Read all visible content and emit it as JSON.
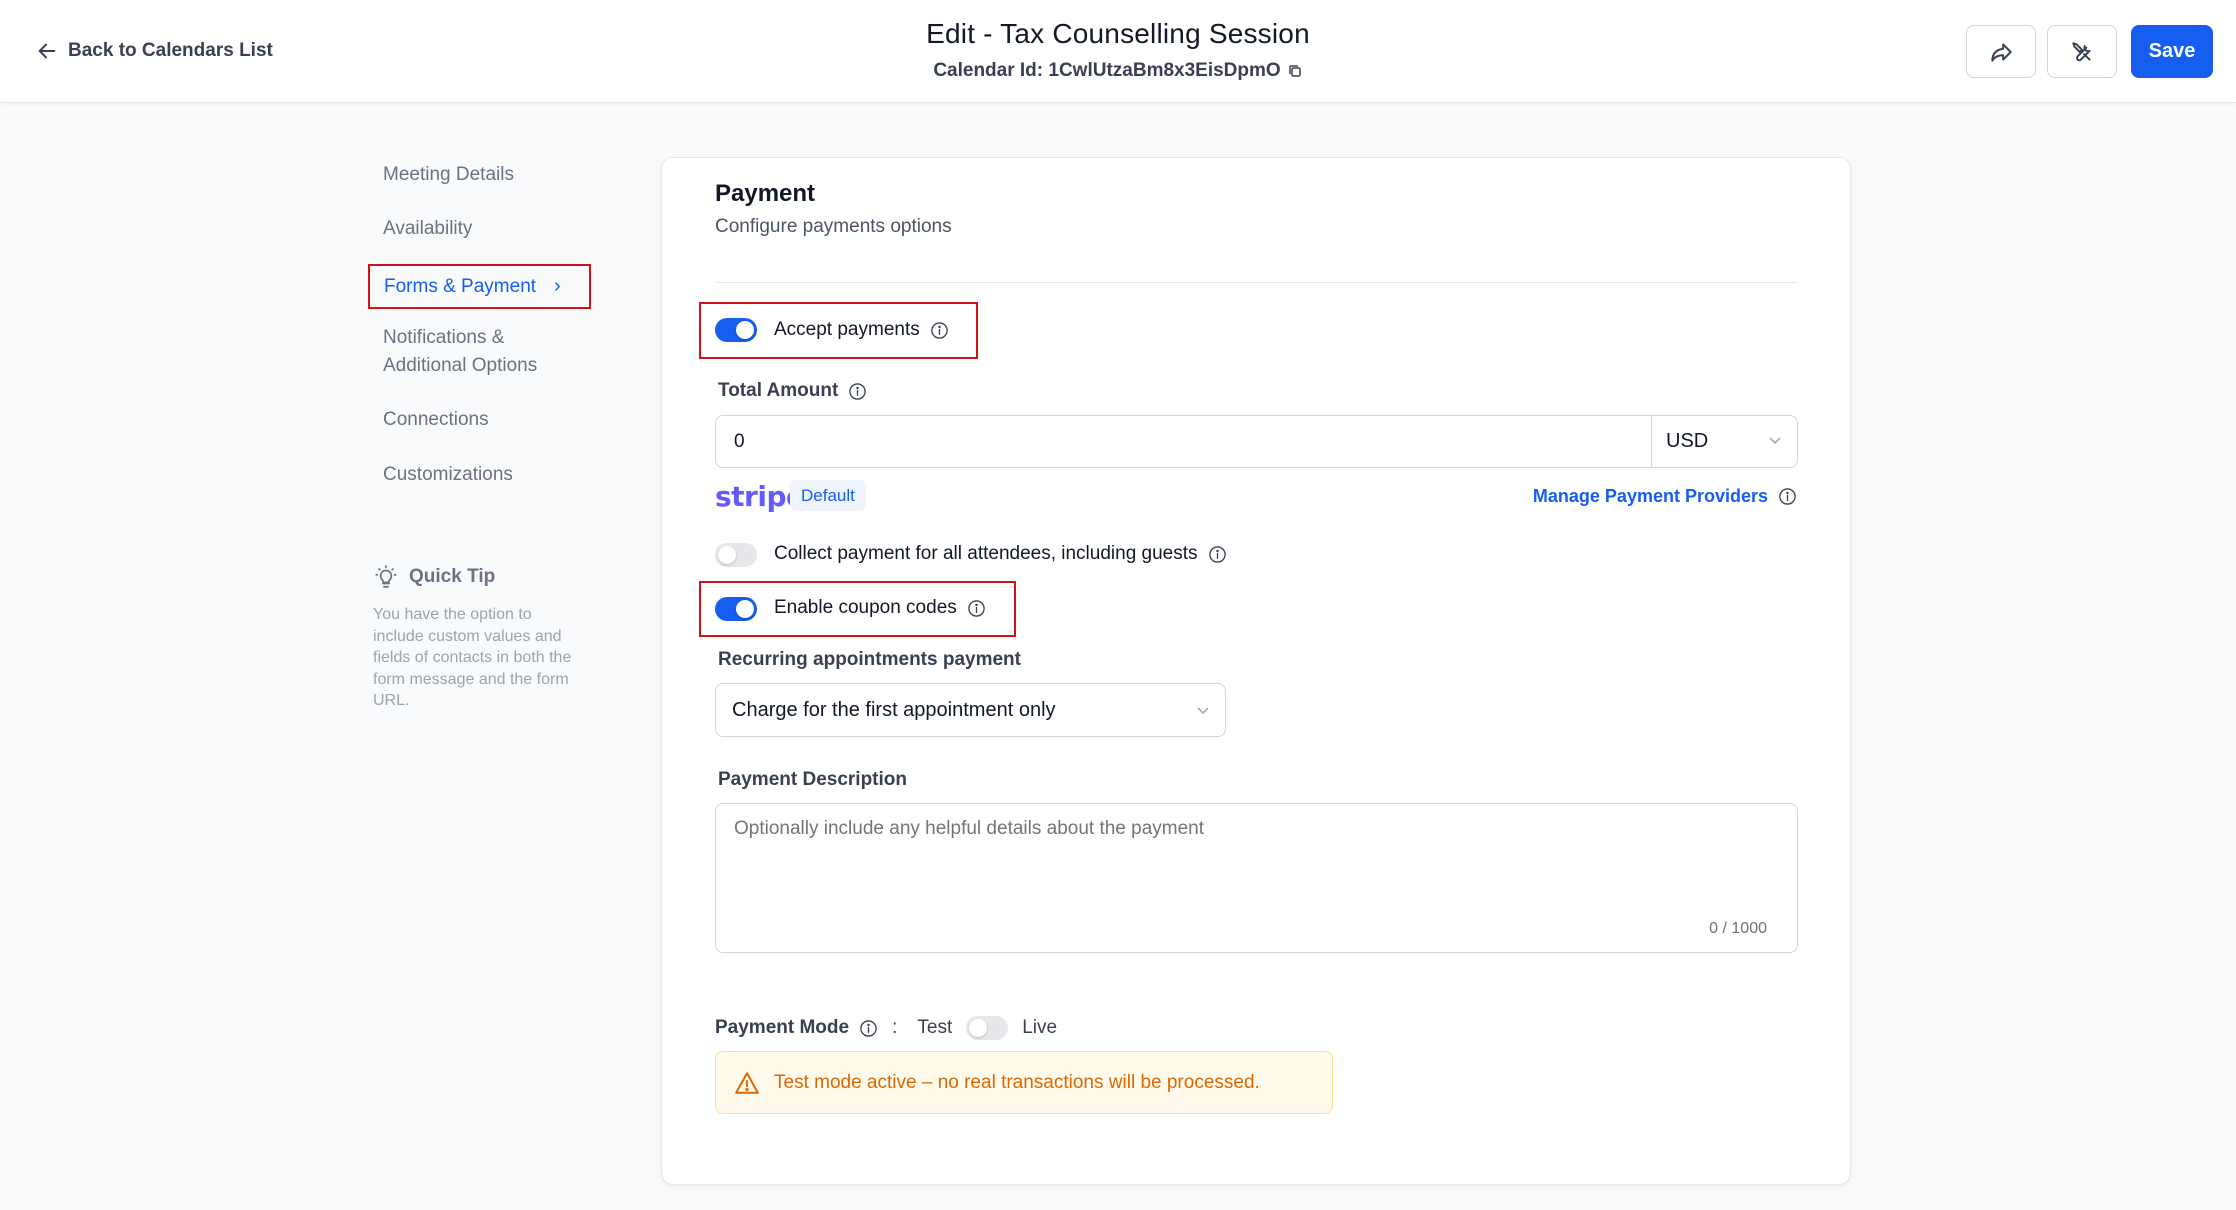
{
  "header": {
    "back_label": "Back to Calendars List",
    "title": "Edit - Tax Counselling Session",
    "calendar_id": "Calendar Id: 1CwlUtzaBm8x3EisDpmO",
    "save_label": "Save"
  },
  "sidebar": {
    "items": [
      {
        "label": "Meeting Details"
      },
      {
        "label": "Availability"
      },
      {
        "label": "Forms & Payment"
      },
      {
        "label": "Notifications &"
      },
      {
        "label": "Additional Options"
      },
      {
        "label": "Connections"
      },
      {
        "label": "Customizations"
      }
    ],
    "active_chevron": "›",
    "tip_title": "Quick Tip",
    "tip_body": "You have the option to include custom values and fields of contacts in both the form message and the form URL."
  },
  "payment": {
    "title": "Payment",
    "subtitle": "Configure payments options",
    "accept_payments": {
      "label": "Accept payments",
      "enabled": true
    },
    "total_amount_label": "Total Amount",
    "total_amount_value": "0",
    "currency": "USD",
    "provider_name": "stripe",
    "provider_badge": "Default",
    "manage_providers": "Manage Payment Providers",
    "collect_all": {
      "label": "Collect payment for all attendees, including guests",
      "enabled": false
    },
    "coupon_codes": {
      "label": "Enable coupon codes",
      "enabled": true
    },
    "recurring_label": "Recurring appointments payment",
    "recurring_value": "Charge for the first appointment only",
    "description_label": "Payment Description",
    "description_placeholder": "Optionally include any helpful details about the payment",
    "description_counter": "0 / 1000",
    "mode_label": "Payment Mode",
    "mode_separator": ":",
    "mode_test": "Test",
    "mode_live": "Live",
    "mode_live_enabled": false,
    "warning": "Test mode active – no real transactions will be processed."
  },
  "colors": {
    "accent": "#155eef",
    "highlight_border": "#d0101a",
    "warning_text": "#dc6803",
    "stripe": "#635bff"
  },
  "icons": [
    "arrow-left-icon",
    "copy-icon",
    "share-icon",
    "tools-icon",
    "lightbulb-icon",
    "info-icon",
    "chevron-down-icon",
    "warning-icon"
  ]
}
